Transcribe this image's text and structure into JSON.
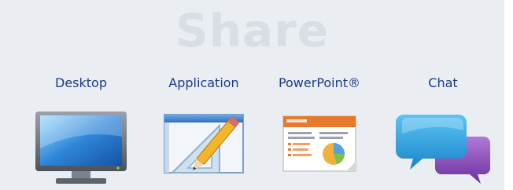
{
  "title": "Share",
  "items": [
    {
      "label": "Desktop",
      "icon": "monitor-icon"
    },
    {
      "label": "Application",
      "icon": "application-window-icon"
    },
    {
      "label": "PowerPoint®",
      "icon": "presentation-icon"
    },
    {
      "label": "Chat",
      "icon": "chat-bubbles-icon"
    }
  ],
  "colors": {
    "panel_background": "#eaedf1",
    "title": "#d7dee6",
    "label": "#1b3a8a",
    "powerpoint_accent": "#e8782a",
    "chat_blue": "#2aa0e0",
    "chat_purple": "#8b4fb8"
  }
}
